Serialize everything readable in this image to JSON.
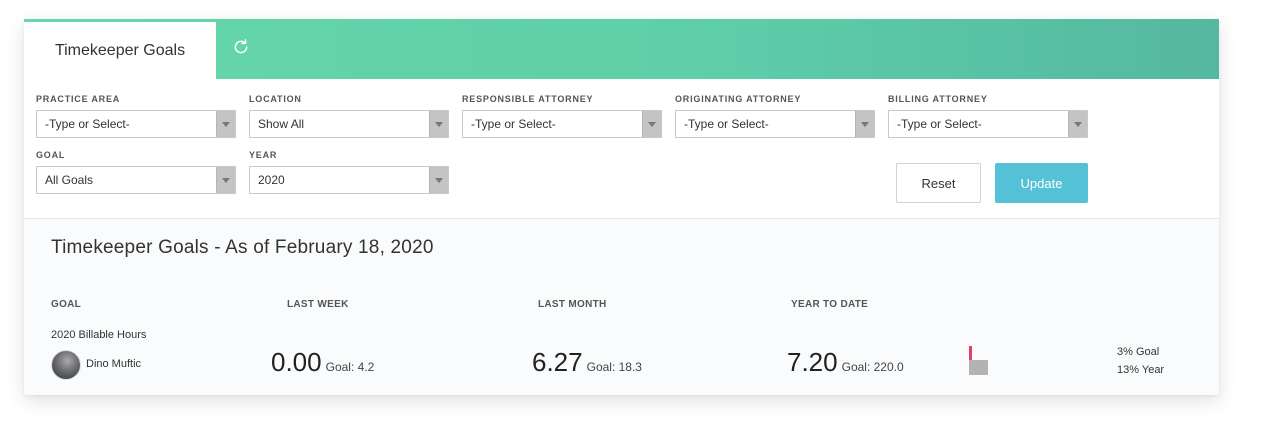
{
  "tabs": {
    "active_label": "Timekeeper Goals",
    "refresh_icon": "refresh-icon"
  },
  "filters": {
    "practice_area": {
      "label": "PRACTICE AREA",
      "value": "-Type or Select-"
    },
    "location": {
      "label": "LOCATION",
      "value": "Show All"
    },
    "responsible_attorney": {
      "label": "RESPONSIBLE ATTORNEY",
      "value": "-Type or Select-"
    },
    "originating_attorney": {
      "label": "ORIGINATING ATTORNEY",
      "value": "-Type or Select-"
    },
    "billing_attorney": {
      "label": "BILLING ATTORNEY",
      "value": "-Type or Select-"
    },
    "goal": {
      "label": "GOAL",
      "value": "All Goals"
    },
    "year": {
      "label": "YEAR",
      "value": "2020"
    }
  },
  "buttons": {
    "reset": "Reset",
    "update": "Update"
  },
  "report": {
    "title": "Timekeeper Goals - As of February 18, 2020",
    "columns": {
      "goal": "GOAL",
      "last_week": "LAST WEEK",
      "last_month": "LAST MONTH",
      "year_to_date": "YEAR TO DATE"
    },
    "row": {
      "goal_name": "2020 Billable Hours",
      "person": "Dino Muftic",
      "last_week": {
        "value": "0.00",
        "goal": "Goal: 4.2"
      },
      "last_month": {
        "value": "6.27",
        "goal": "Goal: 18.3"
      },
      "year_to_date": {
        "value": "7.20",
        "goal": "Goal: 220.0"
      },
      "pct_goal": "3% Goal",
      "pct_year": "13% Year"
    }
  },
  "colors": {
    "header_gradient_start": "#67d6aa",
    "header_gradient_end": "#55b8a0",
    "update_button": "#55c1d6",
    "gauge_red": "#e04362",
    "gauge_gray": "#b3b3b3"
  }
}
